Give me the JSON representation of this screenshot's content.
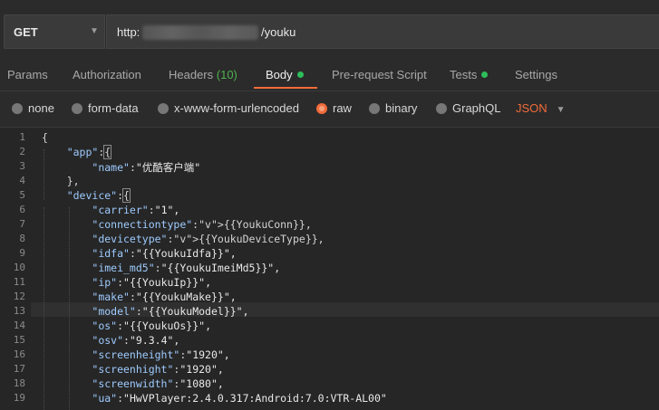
{
  "request": {
    "method": "GET",
    "url_prefix": "http:",
    "url_suffix": "/youku"
  },
  "tabs": [
    {
      "label": "Params"
    },
    {
      "label": "Authorization"
    },
    {
      "label": "Headers",
      "count": "(10)"
    },
    {
      "label": "Body",
      "dot": true
    },
    {
      "label": "Pre-request Script"
    },
    {
      "label": "Tests",
      "dot": true
    },
    {
      "label": "Settings"
    }
  ],
  "body_types": [
    "none",
    "form-data",
    "x-www-form-urlencoded",
    "raw",
    "binary",
    "GraphQL"
  ],
  "selected_body_type": "raw",
  "format": "JSON",
  "editor": {
    "line_numbers": [
      "1",
      "2",
      "3",
      "4",
      "5",
      "6",
      "7",
      "8",
      "9",
      "10",
      "11",
      "12",
      "13",
      "14",
      "15",
      "16",
      "17",
      "18",
      "19"
    ],
    "lines": [
      "{",
      "    \"app\":{",
      "        \"name\":\"优酷客户端\"",
      "    },",
      "    \"device\":{",
      "        \"carrier\":\"1\",",
      "        \"connectiontype\":{{YoukuConn}},",
      "        \"devicetype\":{{YoukuDeviceType}},",
      "        \"idfa\":\"{{YoukuIdfa}}\",",
      "        \"imei_md5\":\"{{YoukuImeiMd5}}\",",
      "        \"ip\":\"{{YoukuIp}}\",",
      "        \"make\":\"{{YoukuMake}}\",",
      "        \"model\":\"{{YoukuModel}}\",",
      "        \"os\":\"{{YoukuOs}}\",",
      "        \"osv\":\"9.3.4\",",
      "        \"screenheight\":\"1920\",",
      "        \"screenhight\":\"1920\",",
      "        \"screenwidth\":\"1080\",",
      "        \"ua\":\"HwVPlayer:2.4.0.317:Android:7.0:VTR-AL00\""
    ]
  },
  "colors": {
    "accent": "#f26b3a",
    "active_dot": "#2ebd5a",
    "headers_count": "#4fb04f"
  }
}
